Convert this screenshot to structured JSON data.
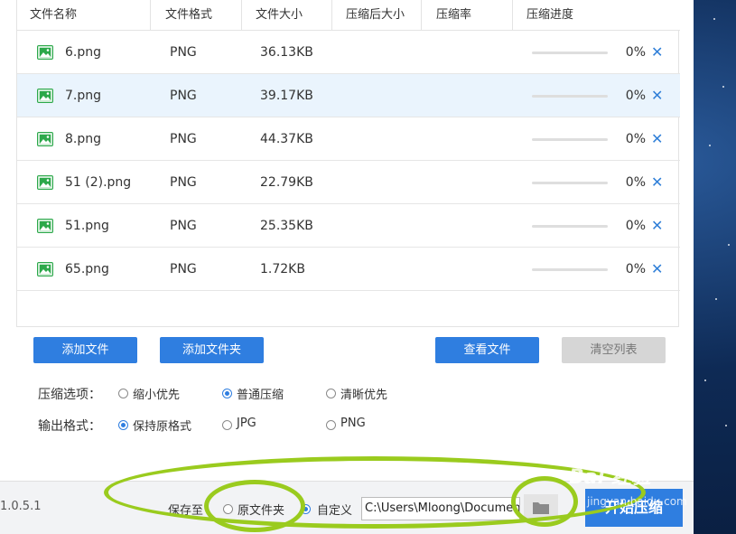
{
  "table": {
    "headers": [
      "文件名称",
      "文件格式",
      "文件大小",
      "压缩后大小",
      "压缩率",
      "压缩进度"
    ],
    "rows": [
      {
        "name": "6.png",
        "format": "PNG",
        "size": "36.13KB",
        "progress": "0%"
      },
      {
        "name": "7.png",
        "format": "PNG",
        "size": "39.17KB",
        "progress": "0%"
      },
      {
        "name": "8.png",
        "format": "PNG",
        "size": "44.37KB",
        "progress": "0%"
      },
      {
        "name": "51 (2).png",
        "format": "PNG",
        "size": "22.79KB",
        "progress": "0%"
      },
      {
        "name": "51.png",
        "format": "PNG",
        "size": "25.35KB",
        "progress": "0%"
      },
      {
        "name": "65.png",
        "format": "PNG",
        "size": "1.72KB",
        "progress": "0%"
      }
    ],
    "delete_glyph": "✕"
  },
  "actions": {
    "add_file": "添加文件",
    "add_folder": "添加文件夹",
    "view_file": "查看文件",
    "clear_list": "清空列表"
  },
  "options": {
    "compress_label": "压缩选项：",
    "compress_choices": [
      "缩小优先",
      "普通压缩",
      "清晰优先"
    ],
    "compress_selected": "普通压缩",
    "format_label": "输出格式：",
    "format_choices": [
      "保持原格式",
      "JPG",
      "PNG"
    ],
    "format_selected": "保持原格式"
  },
  "footer": {
    "version": "1.0.5.1",
    "save_to_label": "保存至",
    "save_original": "原文件夹",
    "save_custom": "自定义",
    "save_selected": "自定义",
    "path_value": "C:\\Users\\Mloong\\Documents",
    "start_label": "开始压缩"
  },
  "watermark": {
    "text": "Bai 经验",
    "url": "jingyan.baidu.com"
  },
  "colors": {
    "accent": "#2f7ee0",
    "file_icon": "#2ca84a",
    "annotation": "#9acb1e"
  }
}
